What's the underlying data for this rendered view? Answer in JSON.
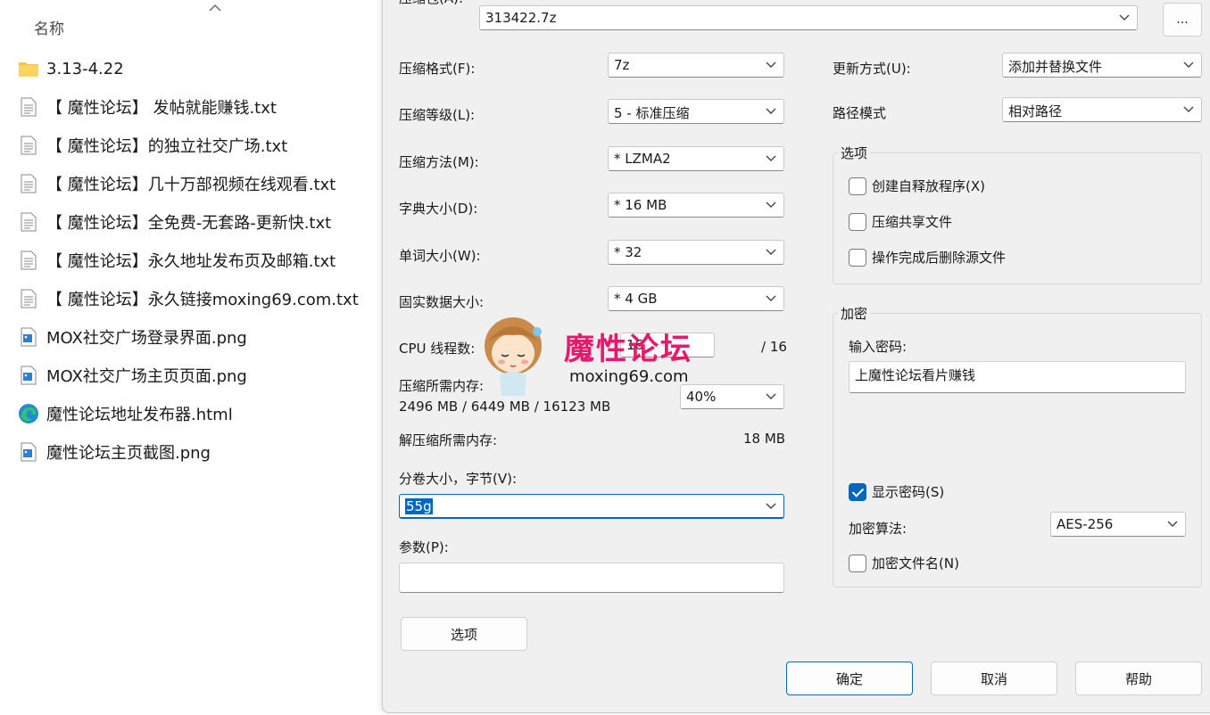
{
  "explorer": {
    "column_header": "名称",
    "files": [
      {
        "name": "3.13-4.22",
        "icon": "folder-icon"
      },
      {
        "name": "【 魔性论坛】 发帖就能赚钱.txt",
        "icon": "text-file-icon"
      },
      {
        "name": "【 魔性论坛】的独立社交广场.txt",
        "icon": "text-file-icon"
      },
      {
        "name": "【 魔性论坛】几十万部视频在线观看.txt",
        "icon": "text-file-icon"
      },
      {
        "name": "【 魔性论坛】全免费-无套路-更新快.txt",
        "icon": "text-file-icon"
      },
      {
        "name": "【 魔性论坛】永久地址发布页及邮箱.txt",
        "icon": "text-file-icon"
      },
      {
        "name": "【 魔性论坛】永久链接moxing69.com.txt",
        "icon": "text-file-icon"
      },
      {
        "name": "MOX社交广场登录界面.png",
        "icon": "image-file-icon"
      },
      {
        "name": "MOX社交广场主页页面.png",
        "icon": "image-file-icon"
      },
      {
        "name": "魔性论坛地址发布器.html",
        "icon": "edge-browser-icon"
      },
      {
        "name": "魔性论坛主页截图.png",
        "icon": "image-file-icon"
      }
    ]
  },
  "dialog": {
    "archive_label": "压缩包(A):",
    "archive_value": "313422.7z",
    "browse_button": "...",
    "format_label": "压缩格式(F):",
    "format_value": "7z",
    "level_label": "压缩等级(L):",
    "level_value": "5 - 标准压缩",
    "method_label": "压缩方法(M):",
    "method_value": "*  LZMA2",
    "dict_label": "字典大小(D):",
    "dict_value": "*  16 MB",
    "word_label": "单词大小(W):",
    "word_value": "*  32",
    "solid_label": "固实数据大小:",
    "solid_value": "*  4 GB",
    "threads_label": "CPU 线程数:",
    "threads_value": "16",
    "threads_total": "/ 16",
    "mem_label": "压缩所需内存:",
    "mem_value": "2496 MB / 6449 MB / 16123 MB",
    "mem_percent": "40%",
    "decomp_label": "解压缩所需内存:",
    "decomp_value": "18 MB",
    "volume_label": "分卷大小，字节(V):",
    "volume_value": "55g",
    "params_label": "参数(P):",
    "params_value": "",
    "options_button": "选项",
    "update_label": "更新方式(U):",
    "update_value": "添加并替换文件",
    "path_label": "路径模式",
    "path_value": "相对路径",
    "options_group": "选项",
    "opt_sfx": "创建自释放程序(X)",
    "opt_shared": "压缩共享文件",
    "opt_delete": "操作完成后删除源文件",
    "encrypt_group": "加密",
    "password_label": "输入密码:",
    "password_value": "上魔性论坛看片赚钱",
    "show_password": "显示密码(S)",
    "show_password_checked": true,
    "enc_method_label": "加密算法:",
    "enc_method_value": "AES-256",
    "encrypt_names": "加密文件名(N)",
    "ok_button": "确定",
    "cancel_button": "取消",
    "help_button": "帮助"
  },
  "watermark": {
    "text": "魔性论坛",
    "url": "moxing69.com"
  },
  "colors": {
    "accent": "#0067c0",
    "watermark": "#e8186d",
    "dialog_bg": "#f0f0f0"
  }
}
